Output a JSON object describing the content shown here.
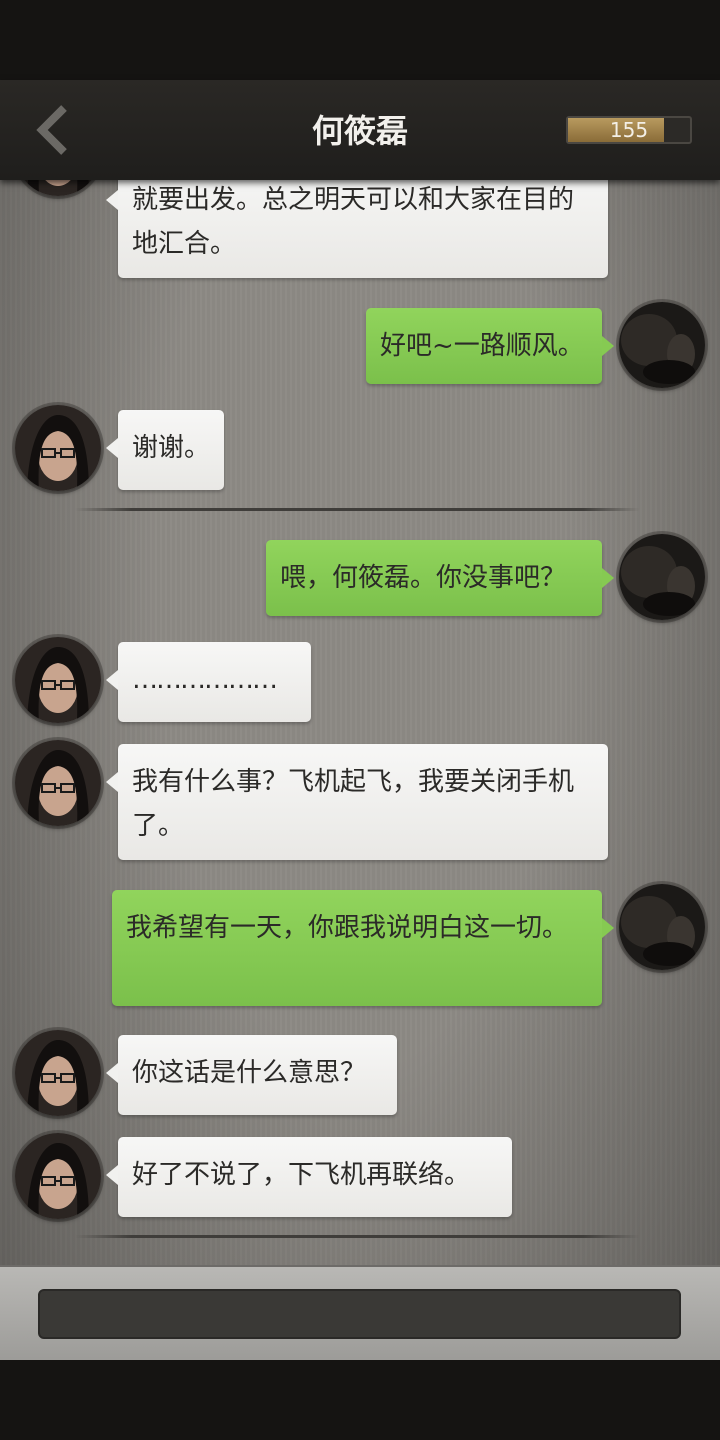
{
  "header": {
    "title": "何筱磊",
    "energy_value": "155",
    "energy_level": 0.79
  },
  "messages": [
    {
      "side": "in",
      "text": "就要出发。总之明天可以和大家在目的地汇合。",
      "avatar": "contact-avatar"
    },
    {
      "side": "out",
      "text": "好吧~一路顺风。",
      "avatar": "player-avatar"
    },
    {
      "side": "in",
      "text": "谢谢。",
      "avatar": "contact-avatar"
    },
    {
      "side": "out",
      "text": "喂，何筱磊。你没事吧？",
      "avatar": "player-avatar"
    },
    {
      "side": "in",
      "text": "………………",
      "avatar": "contact-avatar"
    },
    {
      "side": "in",
      "text": "我有什么事？飞机起飞，我要关闭手机了。",
      "avatar": "contact-avatar"
    },
    {
      "side": "out",
      "text": "我希望有一天，你跟我说明白这一切。",
      "avatar": "player-avatar"
    },
    {
      "side": "in",
      "text": "你这话是什么意思？",
      "avatar": "contact-avatar"
    },
    {
      "side": "in",
      "text": "好了不说了，下飞机再联络。",
      "avatar": "contact-avatar"
    }
  ],
  "input": {
    "value": "",
    "placeholder": ""
  },
  "colors": {
    "incoming_bubble": "#f2f2f0",
    "outgoing_bubble": "#86ca52",
    "header_bg": "#252320",
    "background": "#8d8a85"
  },
  "icons": {
    "back": "chevron-left-icon"
  }
}
